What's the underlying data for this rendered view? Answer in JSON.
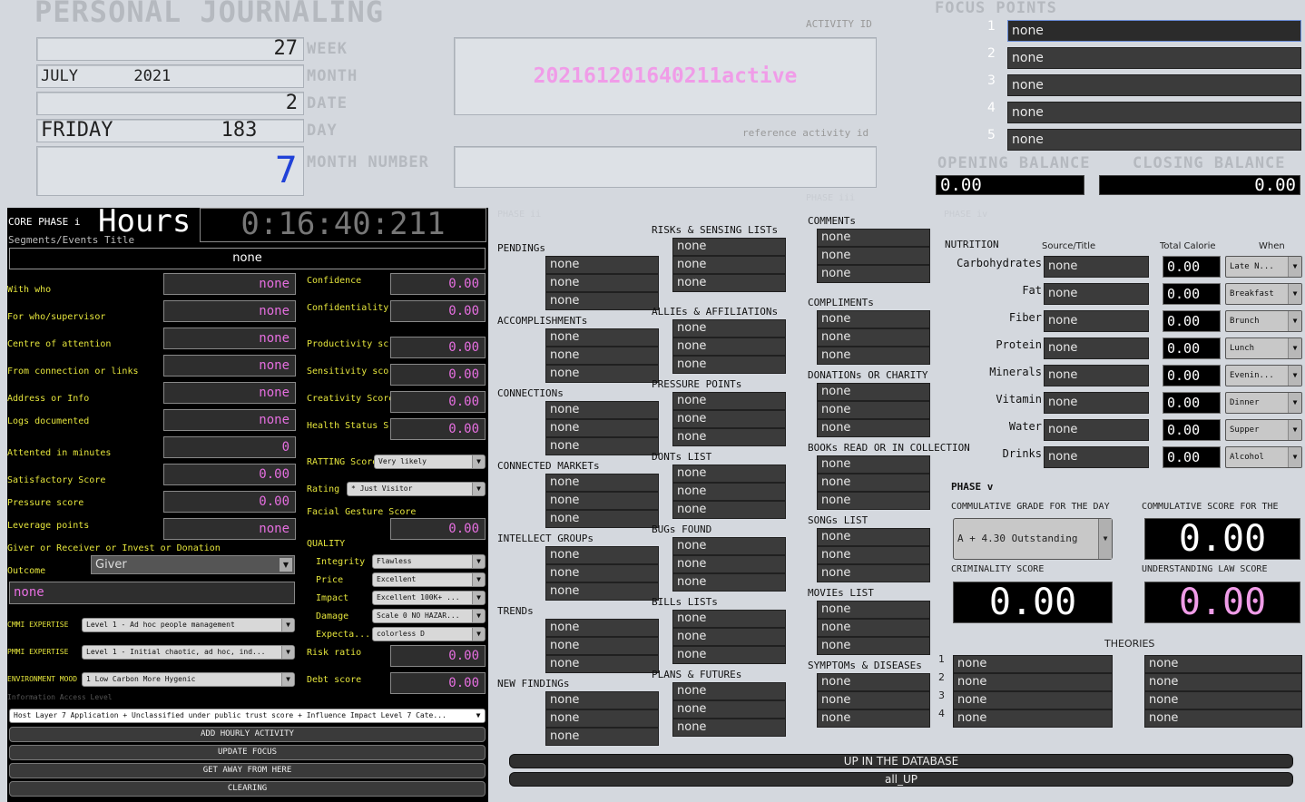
{
  "header": {
    "title": "PERSONAL JOURNALING",
    "week_value": "27",
    "week_label": "WEEK",
    "month_value": "JULY      2021",
    "month_label": "MONTH",
    "date_value": "2",
    "date_label": "DATE",
    "day_value": "FRIDAY         183",
    "day_label": "DAY",
    "month_number_value": "7",
    "month_number_label": "MONTH NUMBER"
  },
  "activity": {
    "id_label": "ACTIVITY ID",
    "id_value": "202161201640211active",
    "ref_label": "reference activity id"
  },
  "focus": {
    "title": "FOCUS POINTS",
    "items": [
      {
        "n": "1",
        "v": "none"
      },
      {
        "n": "2",
        "v": "none"
      },
      {
        "n": "3",
        "v": "none"
      },
      {
        "n": "4",
        "v": "none"
      },
      {
        "n": "5",
        "v": "none"
      }
    ]
  },
  "balance": {
    "opening_label": "OPENING BALANCE",
    "opening_value": "0.00",
    "closing_label": "CLOSING BALANCE",
    "closing_value": "0.00"
  },
  "core": {
    "phase_label": "CORE PHASE i",
    "hours_label": "Hours",
    "time": "0:16:40:211",
    "segments_label": "Segments/Events Title",
    "segments_value": "none",
    "left_fields": [
      {
        "l": "With who",
        "v": "none"
      },
      {
        "l": "For who/supervisor",
        "v": "none"
      },
      {
        "l": "Centre of attention",
        "v": "none"
      },
      {
        "l": "From connection or links",
        "v": "none"
      },
      {
        "l": "Address or Info",
        "v": "none"
      },
      {
        "l": "Logs documented",
        "v": "none"
      },
      {
        "l": "Attented in minutes",
        "v": "0"
      },
      {
        "l": "Satisfactory Score",
        "v": "0.00"
      },
      {
        "l": "Pressure score",
        "v": "0.00"
      },
      {
        "l": "Leverage points",
        "v": "none"
      }
    ],
    "right_fields": [
      {
        "l": "Confidence",
        "v": "0.00"
      },
      {
        "l": "Confidentiality",
        "v": "0.00"
      },
      {
        "l": "Productivity sc",
        "v": "0.00"
      },
      {
        "l": "Sensitivity score",
        "v": "0.00"
      },
      {
        "l": "Creativity Score",
        "v": "0.00"
      },
      {
        "l": "Health Status S",
        "v": "0.00"
      }
    ],
    "ratting_label": "RATTING Score",
    "ratting_value": "Very likely",
    "rating_label": "Rating",
    "rating_value": "* Just Visitor",
    "facial_label": "Facial Gesture Score",
    "facial_value": "0.00",
    "giver_label": "Giver or Receiver or Invest or Donation",
    "outcome_label": "Outcome",
    "outcome_value": "Giver",
    "outcome_text": "none",
    "quality_label": "QUALITY",
    "quality": [
      {
        "l": "Integrity",
        "v": "Flawless"
      },
      {
        "l": "Price",
        "v": "Excellent"
      },
      {
        "l": "Impact",
        "v": "Excellent 100K+ ..."
      },
      {
        "l": "Damage",
        "v": "Scale 0 NO HAZAR..."
      },
      {
        "l": "Expecta...",
        "v": "colorless D"
      }
    ],
    "cmmi_label": "CMMI EXPERTISE",
    "cmmi_value": "Level 1 - Ad hoc people management",
    "pmmi_label": "PMMI EXPERTISE",
    "pmmi_value": "Level 1 - Initial chaotic, ad hoc, ind...",
    "env_label": "ENVIRONMENT MOOD",
    "env_value": "1 Low Carbon More Hygenic",
    "risk_label": "Risk ratio",
    "risk_value": "0.00",
    "debt_label": "Debt score",
    "debt_value": "0.00",
    "access_label": "Information Access Level",
    "access_value": "Host Layer 7 Application + Unclassified under public trust score + Influence Impact Level 7 Cate...",
    "buttons": [
      "ADD HOURLY ACTIVITY",
      "UPDATE FOCUS",
      "GET AWAY FROM HERE",
      "CLEARING"
    ]
  },
  "phase_labels": {
    "ii": "PHASE ii",
    "iii": "PHASE iii",
    "iv": "PHASE iv",
    "v": "PHASE v"
  },
  "col1": [
    {
      "t": "PENDINGs",
      "v": [
        "none",
        "none",
        "none"
      ]
    },
    {
      "t": "ACCOMPLISHMENTs",
      "v": [
        "none",
        "none",
        "none"
      ]
    },
    {
      "t": "CONNECTIONs",
      "v": [
        "none",
        "none",
        "none"
      ]
    },
    {
      "t": "CONNECTED MARKETs",
      "v": [
        "none",
        "none",
        "none"
      ]
    },
    {
      "t": "INTELLECT GROUPs",
      "v": [
        "none",
        "none",
        "none"
      ]
    },
    {
      "t": "TRENDs",
      "v": [
        "none",
        "none",
        "none"
      ]
    },
    {
      "t": "NEW FINDINGs",
      "v": [
        "none",
        "none",
        "none"
      ]
    }
  ],
  "col2": [
    {
      "t": "RISKs & SENSING LISTs",
      "v": [
        "none",
        "none",
        "none"
      ]
    },
    {
      "t": "ALLIEs & AFFILIATIONs",
      "v": [
        "none",
        "none",
        "none"
      ]
    },
    {
      "t": "PRESSURE POINTs",
      "v": [
        "none",
        "none",
        "none"
      ]
    },
    {
      "t": "DONTs LIST",
      "v": [
        "none",
        "none",
        "none"
      ]
    },
    {
      "t": "BUGs FOUND",
      "v": [
        "none",
        "none",
        "none"
      ]
    },
    {
      "t": "BILLs LISTs",
      "v": [
        "none",
        "none",
        "none"
      ]
    },
    {
      "t": "PLANS & FUTUREs",
      "v": [
        "none",
        "none",
        "none"
      ]
    }
  ],
  "col3": [
    {
      "t": "COMMENTs",
      "v": [
        "none",
        "none",
        "none"
      ]
    },
    {
      "t": "COMPLIMENTs",
      "v": [
        "none",
        "none",
        "none"
      ]
    },
    {
      "t": "DONATIONs OR CHARITY",
      "v": [
        "none",
        "none",
        "none"
      ]
    },
    {
      "t": "BOOKs READ OR IN COLLECTION",
      "v": [
        "none",
        "none",
        "none"
      ]
    },
    {
      "t": "SONGs LIST",
      "v": [
        "none",
        "none",
        "none"
      ]
    },
    {
      "t": "MOVIEs LIST",
      "v": [
        "none",
        "none",
        "none"
      ]
    },
    {
      "t": "SYMPTOMs & DISEASEs",
      "v": [
        "none",
        "none",
        "none"
      ]
    }
  ],
  "nutrition": {
    "title": "NUTRITION",
    "source_header": "Source/Title",
    "calorie_header": "Total Calorie",
    "when_header": "When",
    "rows": [
      {
        "l": "Carbohydrates",
        "s": "none",
        "c": "0.00",
        "w": "Late N..."
      },
      {
        "l": "Fat",
        "s": "none",
        "c": "0.00",
        "w": "Breakfast"
      },
      {
        "l": "Fiber",
        "s": "none",
        "c": "0.00",
        "w": "Brunch"
      },
      {
        "l": "Protein",
        "s": "none",
        "c": "0.00",
        "w": "Lunch"
      },
      {
        "l": "Minerals",
        "s": "none",
        "c": "0.00",
        "w": "Evenin..."
      },
      {
        "l": "Vitamin",
        "s": "none",
        "c": "0.00",
        "w": "Dinner"
      },
      {
        "l": "Water",
        "s": "none",
        "c": "0.00",
        "w": "Supper"
      },
      {
        "l": "Drinks",
        "s": "none",
        "c": "0.00",
        "w": "Alcohol"
      }
    ]
  },
  "phase_v": {
    "grade_label": "COMMULATIVE GRADE FOR THE DAY",
    "grade_value": "A + 4.30 Outstanding",
    "score_label": "COMMULATIVE SCORE FOR THE",
    "score_value": "0.00",
    "criminality_label": "CRIMINALITY SCORE",
    "criminality_value": "0.00",
    "law_label": "UNDERSTANDING LAW SCORE",
    "law_value": "0.00",
    "theories_label": "THEORIES",
    "theories_left": [
      {
        "n": "1",
        "v": "none"
      },
      {
        "n": "2",
        "v": "none"
      },
      {
        "n": "3",
        "v": "none"
      },
      {
        "n": "4",
        "v": "none"
      }
    ],
    "theories_right": [
      "none",
      "none",
      "none",
      "none"
    ]
  },
  "bottom_buttons": [
    "UP IN THE DATABASE",
    "all_UP"
  ],
  "colors": {
    "accent_pink": "#e66fe0",
    "label_yellow": "#e4e43c",
    "month_blue": "#2142d8"
  }
}
